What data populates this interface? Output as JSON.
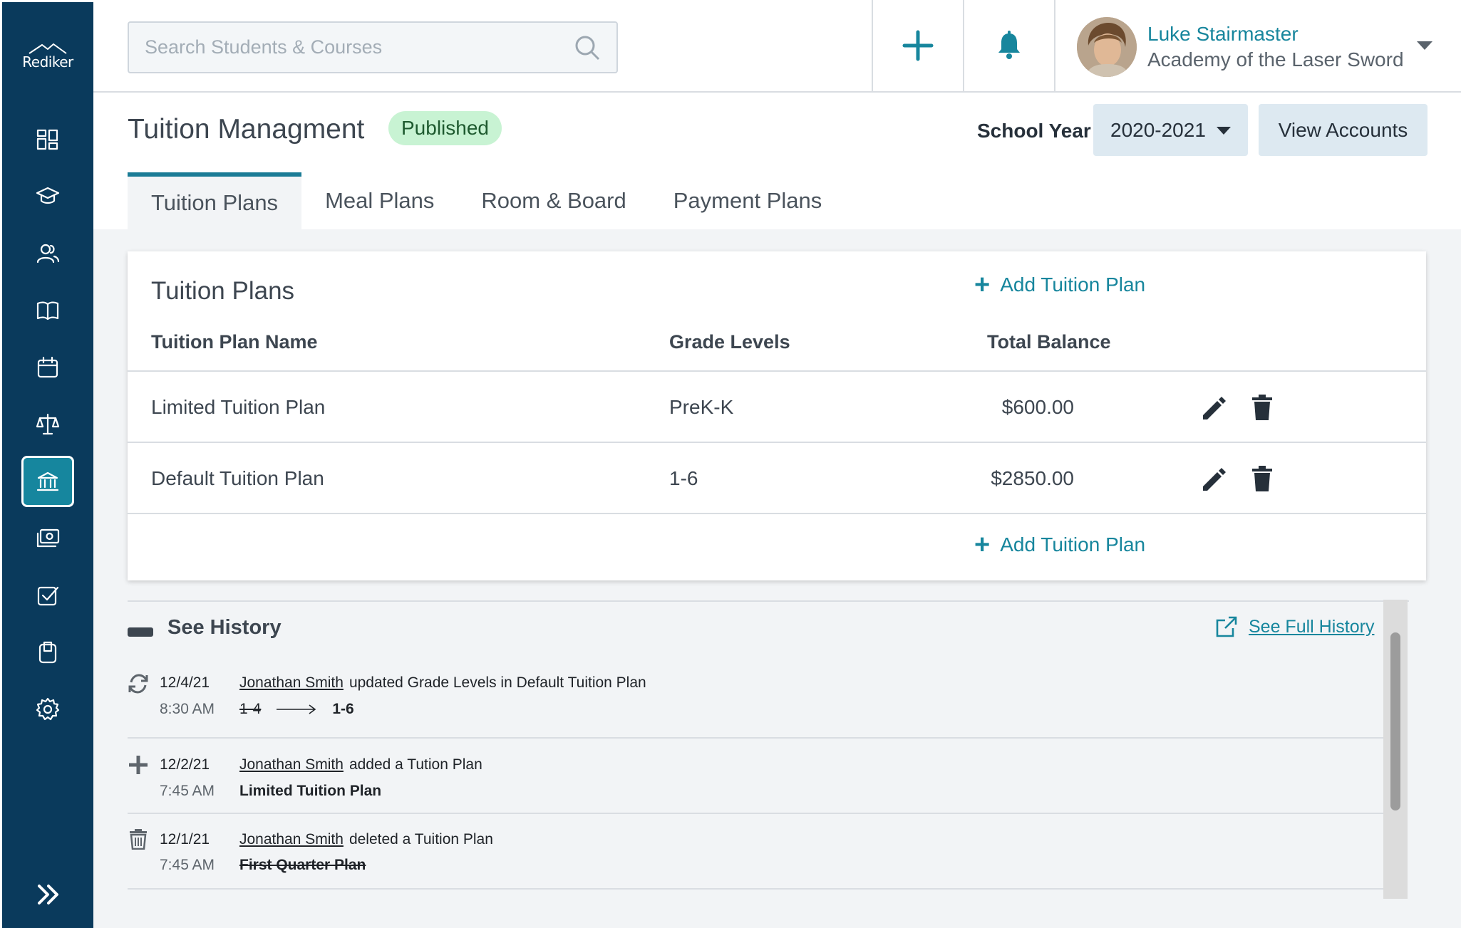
{
  "app": {
    "logo_text": "Rediker"
  },
  "search": {
    "placeholder": "Search Students & Courses"
  },
  "user": {
    "name": "Luke Stairmaster",
    "school": "Academy of the Laser Sword"
  },
  "sidebar": {
    "items": [
      {
        "icon": "dashboard-icon"
      },
      {
        "icon": "graduation-cap-icon"
      },
      {
        "icon": "people-icon"
      },
      {
        "icon": "book-icon"
      },
      {
        "icon": "calendar-icon"
      },
      {
        "icon": "scales-icon"
      },
      {
        "icon": "bank-icon",
        "active": true
      },
      {
        "icon": "money-icon"
      },
      {
        "icon": "checkbox-icon"
      },
      {
        "icon": "clipboard-icon"
      },
      {
        "icon": "gear-icon"
      }
    ],
    "expand_icon": "double-chevron-right-icon"
  },
  "header": {
    "title": "Tuition Managment",
    "status": "Published",
    "school_year_label": "School Year",
    "school_year_value": "2020-2021",
    "view_accounts_label": "View Accounts"
  },
  "tabs": [
    {
      "label": "Tuition Plans",
      "active": true
    },
    {
      "label": "Meal Plans"
    },
    {
      "label": "Room & Board"
    },
    {
      "label": "Payment Plans"
    }
  ],
  "plans_card": {
    "title": "Tuition Plans",
    "add_label": "Add Tuition Plan",
    "columns": [
      "Tuition Plan Name",
      "Grade Levels",
      "Total Balance"
    ],
    "rows": [
      {
        "name": "Limited Tuition Plan",
        "grades": "PreK-K",
        "balance": "$600.00"
      },
      {
        "name": "Default Tuition Plan",
        "grades": "1-6",
        "balance": "$2850.00"
      }
    ]
  },
  "history": {
    "title": "See History",
    "full_history_label": "See Full History",
    "entries": [
      {
        "icon": "refresh-icon",
        "date": "12/4/21",
        "time": "8:30 AM",
        "user": "Jonathan Smith",
        "action": "updated Grade Levels in Default Tuition Plan",
        "old_value": "1-4",
        "new_value": "1-6"
      },
      {
        "icon": "plus-icon",
        "date": "12/2/21",
        "time": "7:45 AM",
        "user": "Jonathan Smith",
        "action": "added a Tution Plan",
        "detail": "Limited Tuition Plan"
      },
      {
        "icon": "trash-icon",
        "date": "12/1/21",
        "time": "7:45 AM",
        "user": "Jonathan Smith",
        "action": "deleted a Tuition Plan",
        "detail": "First Quarter Plan"
      }
    ]
  },
  "colors": {
    "sidebar": "#0a3a5c",
    "accent": "#17869d",
    "badge_bg": "#c8f3d3"
  }
}
